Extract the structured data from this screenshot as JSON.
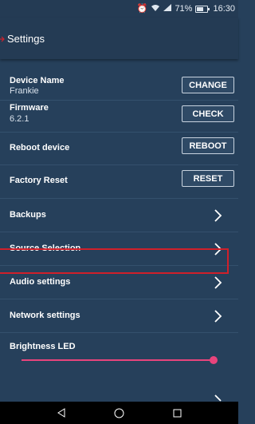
{
  "status_bar": {
    "battery_percent": "71%",
    "time": "16:30",
    "icons": [
      "alarm-icon",
      "wifi-icon",
      "signal-icon",
      "battery-icon"
    ]
  },
  "header": {
    "title": "Settings"
  },
  "settings": {
    "device_name": {
      "label": "Device Name",
      "value": "Frankie",
      "button": "CHANGE"
    },
    "firmware": {
      "label": "Firmware",
      "value": "6.2.1",
      "button": "CHECK"
    },
    "reboot": {
      "label": "Reboot device",
      "button": "REBOOT"
    },
    "factory_reset": {
      "label": "Factory Reset",
      "button": "RESET"
    },
    "backups": {
      "label": "Backups"
    },
    "source_selection": {
      "label": "Source Selection"
    },
    "audio": {
      "label": "Audio settings"
    },
    "network": {
      "label": "Network settings"
    },
    "brightness": {
      "label": "Brightness LED",
      "level": 1.0
    }
  },
  "colors": {
    "background": "#26405b",
    "appbar": "#243b54",
    "accent": "#e8447c",
    "highlight": "#d0202a"
  }
}
